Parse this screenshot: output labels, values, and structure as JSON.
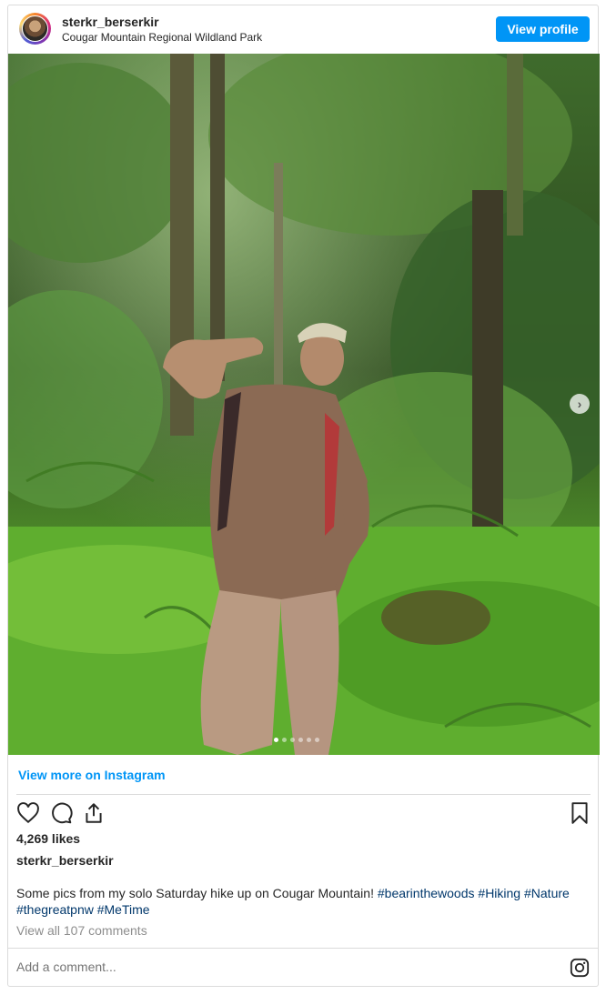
{
  "post": {
    "username": "sterkr_berserkir",
    "location": "Cougar Mountain Regional Wildland Park",
    "view_profile_label": "View profile",
    "view_more_label": "View more on Instagram",
    "likes": "4,269 likes",
    "caption_author": "sterkr_berserkir",
    "caption_text": "Some pics from my solo Saturday hike up on Cougar Mountain!",
    "hashtags": [
      "#bearinthewoods",
      "#Hiking",
      "#Nature",
      "#thegreatpnw",
      "#MeTime"
    ],
    "comments_link": "View all 107 comments",
    "comment_placeholder": "Add a comment...",
    "carousel": {
      "slide_count": 6,
      "active_index": 0
    }
  },
  "icons": {
    "like": "heart-icon",
    "comment": "comment-icon",
    "share": "share-icon",
    "save": "bookmark-icon",
    "brand": "instagram-icon",
    "next": "chevron-right-icon"
  },
  "colors": {
    "accent": "#0095f6",
    "hashtag": "#00376b",
    "muted": "#8e8e8e",
    "text": "#262626"
  }
}
